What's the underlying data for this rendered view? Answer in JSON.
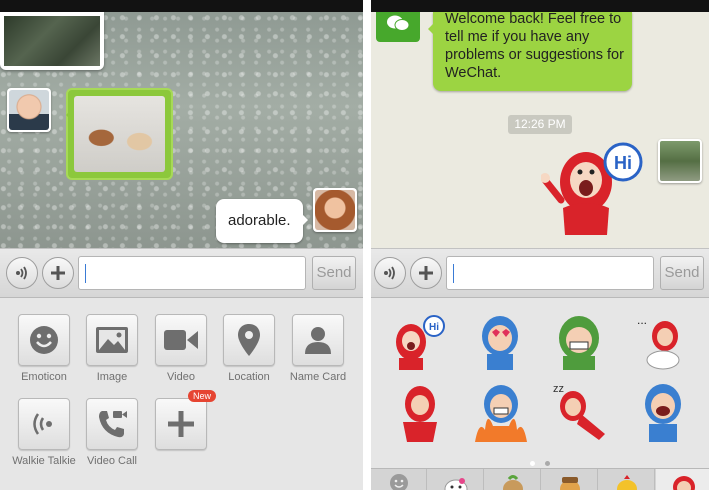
{
  "left_screen": {
    "messages": {
      "incoming_text": "adorable."
    },
    "input": {
      "value": "",
      "placeholder": "",
      "send_label": "Send"
    },
    "tools": [
      {
        "label": "Emoticon",
        "icon": "smiley-icon"
      },
      {
        "label": "Image",
        "icon": "image-icon"
      },
      {
        "label": "Video",
        "icon": "video-camera-icon"
      },
      {
        "label": "Location",
        "icon": "location-pin-icon"
      },
      {
        "label": "Name Card",
        "icon": "person-icon"
      },
      {
        "label": "Walkie Talkie",
        "icon": "walkie-talkie-icon"
      },
      {
        "label": "Video Call",
        "icon": "video-call-icon"
      },
      {
        "label": "",
        "icon": "plus-icon",
        "badge": "New"
      }
    ]
  },
  "right_screen": {
    "messages": {
      "welcome_text": "Welcome back! Feel free to tell me if you have any problems or suggestions for WeChat.",
      "timestamp": "12:26 PM",
      "sticker_text": "Hi"
    },
    "input": {
      "value": "",
      "placeholder": "",
      "send_label": "Send"
    },
    "sticker_page": {
      "current": 1,
      "total": 2
    }
  },
  "colors": {
    "bubble_green": "#9cd442",
    "badge_red": "#e64532",
    "wechat_green": "#47a82c"
  }
}
